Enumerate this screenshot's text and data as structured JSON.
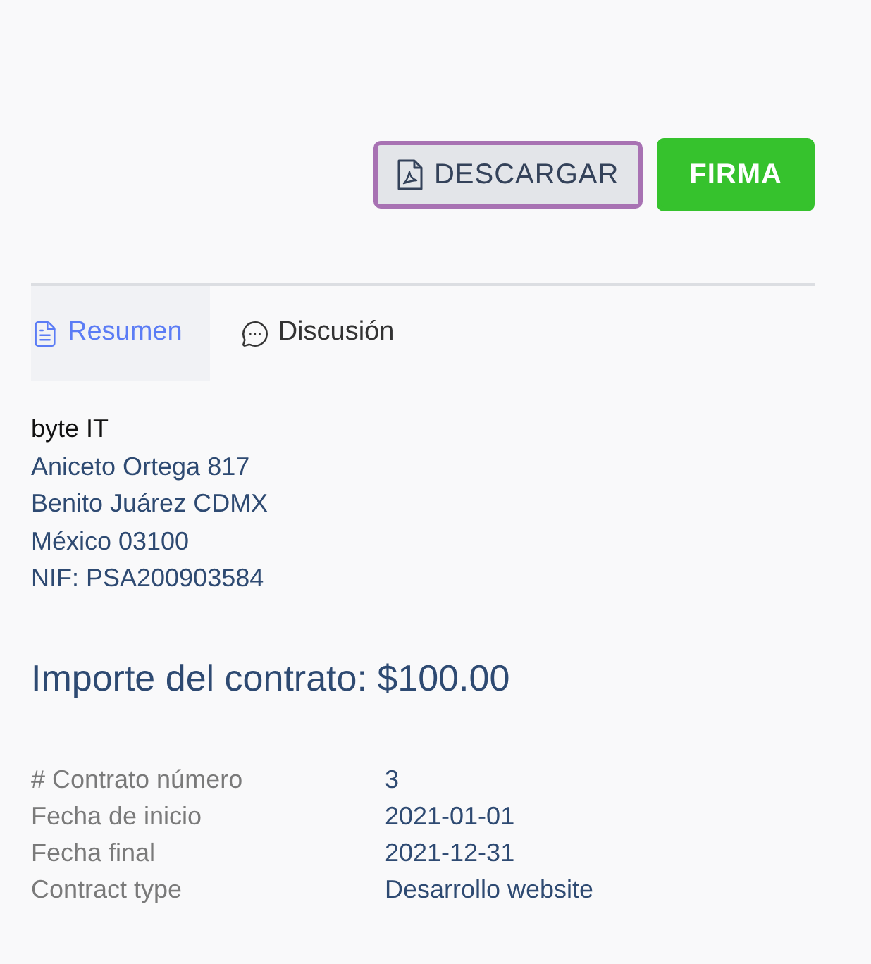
{
  "toolbar": {
    "buttons": [
      {
        "label": "DESCARGAR",
        "kind": "secondary",
        "focused": true
      },
      {
        "label": "FIRMA",
        "kind": "primary",
        "focused": false
      }
    ]
  },
  "tabs": [
    {
      "label": "Resumen",
      "selected": true
    },
    {
      "label": "Discusión",
      "selected": false
    }
  ],
  "client": {
    "name": "byte IT",
    "address_lines": [
      "Aniceto Ortega 817",
      "Benito Juárez CDMX",
      "México 03100",
      "NIF: PSA200903584"
    ]
  },
  "amount_heading": "Importe del contrato: $100.00",
  "details": [
    {
      "label": "# Contrato número",
      "value": "3"
    },
    {
      "label": "Fecha de inicio",
      "value": "2021-01-01"
    },
    {
      "label": "Fecha final",
      "value": "2021-12-31"
    },
    {
      "label": "Contract type",
      "value": "Desarrollo website"
    }
  ]
}
